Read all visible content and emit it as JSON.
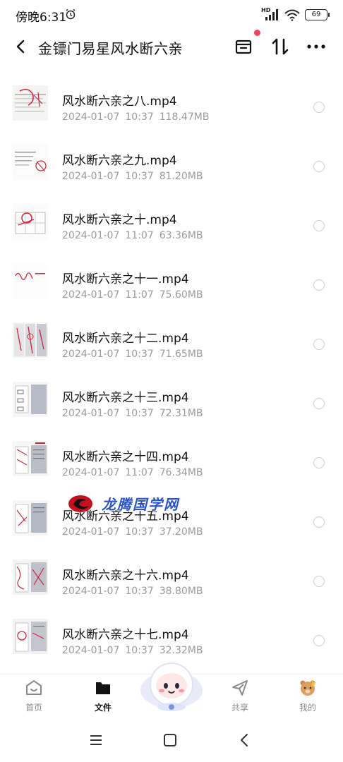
{
  "status_bar": {
    "time": "傍晚6:31",
    "network": "HD",
    "battery": "69"
  },
  "header": {
    "title": "金镖门易星风水断六亲"
  },
  "files": [
    {
      "name": "风水断六亲之八.mp4",
      "date": "2024-01-07",
      "time": "10:37",
      "size": "118.47MB"
    },
    {
      "name": "风水断六亲之九.mp4",
      "date": "2024-01-07",
      "time": "10:37",
      "size": "81.20MB"
    },
    {
      "name": "风水断六亲之十.mp4",
      "date": "2024-01-07",
      "time": "11:07",
      "size": "63.36MB"
    },
    {
      "name": "风水断六亲之十一.mp4",
      "date": "2024-01-07",
      "time": "11:07",
      "size": "75.60MB"
    },
    {
      "name": "风水断六亲之十二.mp4",
      "date": "2024-01-07",
      "time": "10:37",
      "size": "71.65MB"
    },
    {
      "name": "风水断六亲之十三.mp4",
      "date": "2024-01-07",
      "time": "10:37",
      "size": "72.31MB"
    },
    {
      "name": "风水断六亲之十四.mp4",
      "date": "2024-01-07",
      "time": "11:07",
      "size": "76.34MB"
    },
    {
      "name": "风水断六亲之十五.mp4",
      "date": "2024-01-07",
      "time": "10:37",
      "size": "37.20MB"
    },
    {
      "name": "风水断六亲之十六.mp4",
      "date": "2024-01-07",
      "time": "10:37",
      "size": "38.80MB"
    },
    {
      "name": "风水断六亲之十七.mp4",
      "date": "2024-01-07",
      "time": "10:37",
      "size": "32.32MB"
    }
  ],
  "watermark": {
    "text": "龙腾国学网"
  },
  "bottom_nav": {
    "home": "首页",
    "files": "文件",
    "share": "共享",
    "mine": "我的"
  },
  "colors": {
    "accent_red": "#f0455c",
    "meta_gray": "#9a9a9a",
    "watermark_blue": "#2a53c9"
  }
}
